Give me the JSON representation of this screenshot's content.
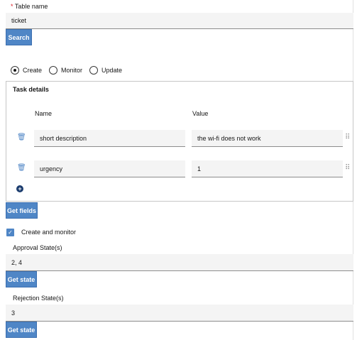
{
  "table_name": {
    "required_mark": "*",
    "label": "Table name",
    "value": "ticket",
    "search_label": "Search"
  },
  "mode": {
    "options": [
      "Create",
      "Monitor",
      "Update"
    ],
    "selected": "Create"
  },
  "task_details": {
    "title": "Task details",
    "col_name": "Name",
    "col_value": "Value",
    "rows": [
      {
        "name": "short description",
        "value": "the wi-fi does not work"
      },
      {
        "name": "urgency",
        "value": "1"
      }
    ],
    "get_fields_label": "Get fields"
  },
  "create_and_monitor": {
    "label": "Create and monitor",
    "checked": true
  },
  "approval": {
    "label": "Approval State(s)",
    "value": "2, 4",
    "button": "Get state"
  },
  "rejection": {
    "label": "Rejection State(s)",
    "value": "3",
    "button": "Get state"
  },
  "colors": {
    "accent": "#4f86c6",
    "field_bg": "#f4f4f4"
  },
  "icons": {
    "trash": "trash-icon",
    "drag": "drag-handle-icon",
    "add": "add-circle-icon",
    "check": "checkmark-icon"
  }
}
